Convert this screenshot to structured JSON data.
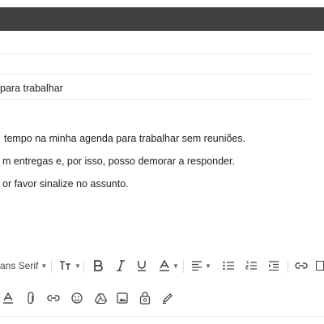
{
  "compose": {
    "subject": "para trabalhar",
    "body_lines": [
      "tempo na minha agenda para trabalhar sem reuniões.",
      "m entregas e, por isso, posso demorar a responder.",
      "or favor sinalize no assunto."
    ]
  },
  "format_toolbar": {
    "font_family": "ans Serif",
    "icons": [
      "font-size-icon",
      "bold-icon",
      "italic-icon",
      "underline-icon",
      "text-color-icon",
      "align-icon",
      "bulleted-list-icon",
      "numbered-list-icon",
      "indent-icon",
      "link-icon",
      "more-icon"
    ]
  },
  "action_toolbar": {
    "icons": [
      "formatting-options-icon",
      "attach-icon",
      "insert-link-icon",
      "emoji-icon",
      "drive-icon",
      "photo-icon",
      "confidential-icon",
      "signature-icon"
    ]
  },
  "colors": {
    "topbar": "#404040",
    "icon": "#444746"
  }
}
